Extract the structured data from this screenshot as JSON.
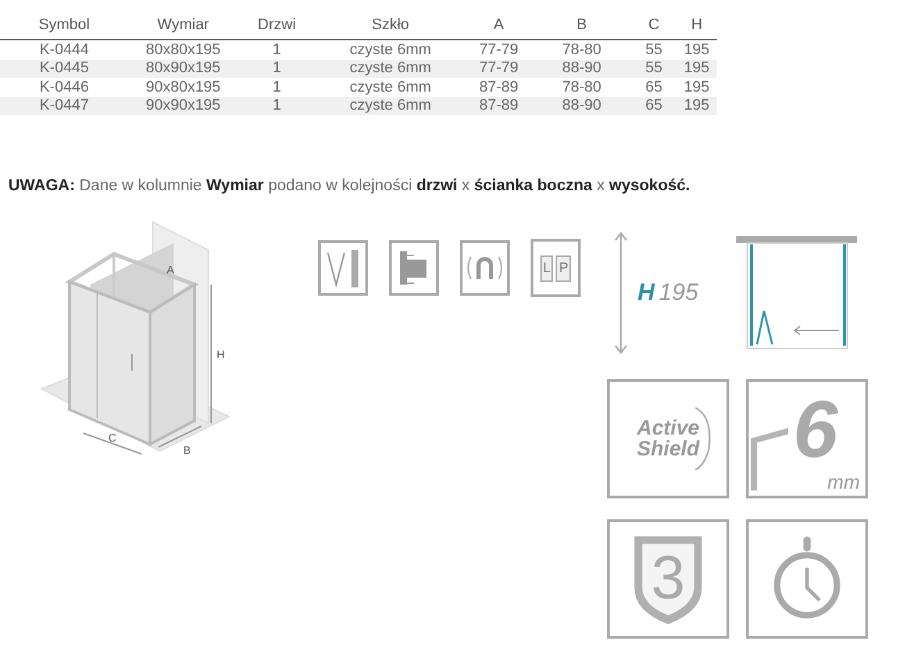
{
  "table": {
    "columns": [
      "Symbol",
      "Wymiar",
      "Drzwi",
      "Szkło",
      "A",
      "B",
      "C",
      "H"
    ],
    "rows": [
      [
        "K-0444",
        "80x80x195",
        "1",
        "czyste 6mm",
        "77-79",
        "78-80",
        "55",
        "195"
      ],
      [
        "K-0445",
        "80x90x195",
        "1",
        "czyste 6mm",
        "77-79",
        "88-90",
        "55",
        "195"
      ],
      [
        "K-0446",
        "90x80x195",
        "1",
        "czyste 6mm",
        "87-89",
        "78-80",
        "65",
        "195"
      ],
      [
        "K-0447",
        "90x90x195",
        "1",
        "czyste 6mm",
        "87-89",
        "88-90",
        "65",
        "195"
      ]
    ]
  },
  "note": "**UWAGA:** Dane w kolumnie **Wymiar** podano w kolejności **drzwi** x **ścianka boczna** x **wysokość.**",
  "drawing_labels": {
    "a": "A",
    "b": "B",
    "c": "C",
    "h": "H"
  },
  "door_icon_letters": [
    "L",
    "P"
  ],
  "height": {
    "letter": "H",
    "value": "195"
  },
  "tiles": [
    {
      "kind": "shield",
      "lines": [
        "Active",
        "Shield"
      ]
    },
    {
      "kind": "glass",
      "value": "6",
      "unit": "mm"
    },
    {
      "kind": "warranty",
      "value": "3"
    },
    {
      "kind": "clock"
    }
  ]
}
